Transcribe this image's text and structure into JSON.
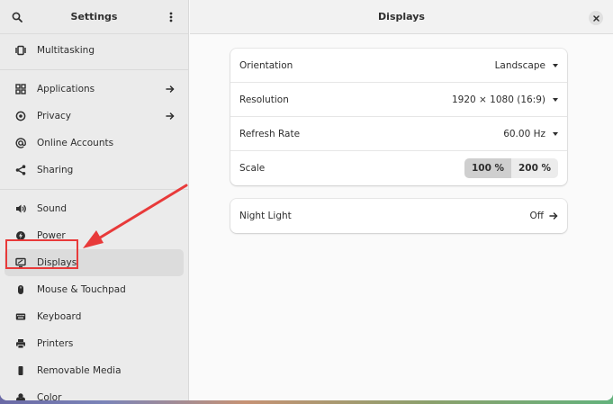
{
  "sidebar": {
    "title": "Settings",
    "search_icon": "search-icon",
    "menu_icon": "kebab-menu-icon",
    "groups": [
      [
        {
          "label": "Multitasking",
          "icon": "multitasking-icon",
          "arrow": false
        }
      ],
      [
        {
          "label": "Applications",
          "icon": "applications-icon",
          "arrow": true
        },
        {
          "label": "Privacy",
          "icon": "privacy-icon",
          "arrow": true
        },
        {
          "label": "Online Accounts",
          "icon": "online-accounts-icon",
          "arrow": false
        },
        {
          "label": "Sharing",
          "icon": "sharing-icon",
          "arrow": false
        }
      ],
      [
        {
          "label": "Sound",
          "icon": "sound-icon",
          "arrow": false
        },
        {
          "label": "Power",
          "icon": "power-icon",
          "arrow": false
        },
        {
          "label": "Displays",
          "icon": "displays-icon",
          "arrow": false,
          "selected": true
        },
        {
          "label": "Mouse & Touchpad",
          "icon": "mouse-icon",
          "arrow": false
        },
        {
          "label": "Keyboard",
          "icon": "keyboard-icon",
          "arrow": false
        },
        {
          "label": "Printers",
          "icon": "printer-icon",
          "arrow": false
        },
        {
          "label": "Removable Media",
          "icon": "removable-media-icon",
          "arrow": false
        },
        {
          "label": "Color",
          "icon": "color-icon",
          "arrow": false
        }
      ]
    ]
  },
  "main": {
    "title": "Displays",
    "display_card": {
      "orientation_label": "Orientation",
      "orientation_value": "Landscape",
      "resolution_label": "Resolution",
      "resolution_value": "1920 × 1080 (16:9)",
      "refresh_label": "Refresh Rate",
      "refresh_value": "60.00 Hz",
      "scale_label": "Scale",
      "scale_options": [
        "100 %",
        "200 %"
      ],
      "scale_selected": "100 %"
    },
    "night_light": {
      "label": "Night Light",
      "value": "Off"
    }
  },
  "annotation": {
    "color": "#e83a3a"
  }
}
